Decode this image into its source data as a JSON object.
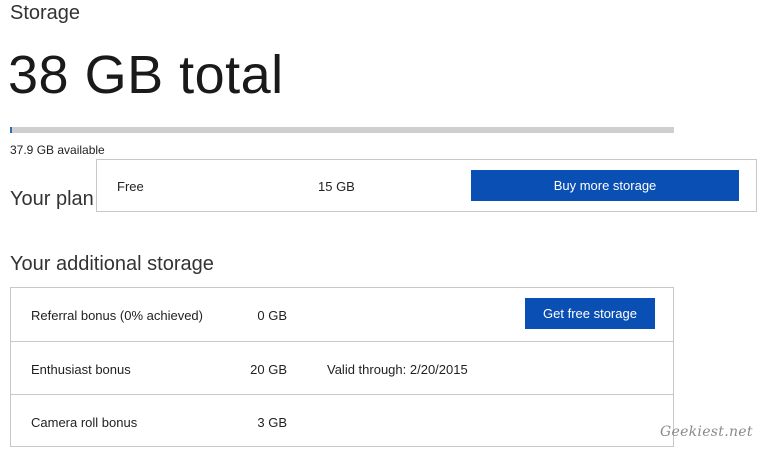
{
  "storage": {
    "section_label": "Storage",
    "total": "38 GB total",
    "available": "37.9 GB available",
    "used_fraction": 0.0026
  },
  "plan": {
    "heading": "Your plan",
    "name": "Free",
    "size": "15 GB",
    "buy_label": "Buy more storage"
  },
  "additional": {
    "heading": "Your additional storage",
    "rows": [
      {
        "name": "Referral bonus (0% achieved)",
        "size": "0 GB",
        "action_label": "Get free storage"
      },
      {
        "name": "Enthusiast bonus",
        "size": "20 GB",
        "valid": "Valid through: 2/20/2015"
      },
      {
        "name": "Camera roll bonus",
        "size": "3 GB"
      }
    ]
  },
  "watermark": "Geekiest.net",
  "colors": {
    "accent": "#0a4fb3",
    "bar_track": "#cfcfcf"
  }
}
